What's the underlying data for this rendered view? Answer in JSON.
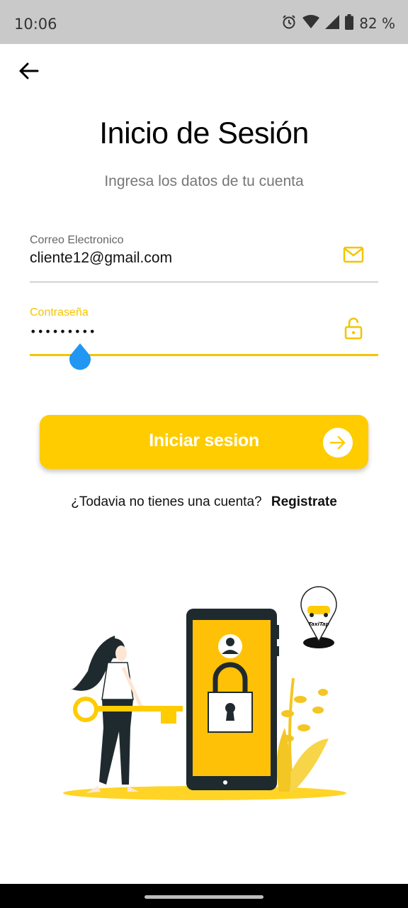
{
  "status_bar": {
    "time": "10:06",
    "battery": "82 %",
    "icons": [
      "alarm-icon",
      "wifi-icon",
      "signal-icon",
      "battery-icon"
    ]
  },
  "header": {
    "back_icon": "back-arrow-icon",
    "title": "Inicio de Sesión",
    "subtitle": "Ingresa los datos de tu cuenta"
  },
  "form": {
    "email": {
      "label": "Correo Electronico",
      "value": "cliente12@gmail.com",
      "icon": "mail-icon"
    },
    "password": {
      "label": "Contraseña",
      "value": "•••••••••",
      "icon": "unlock-icon"
    }
  },
  "login_button": {
    "label": "Iniciar sesion",
    "icon": "arrow-right-circle-icon"
  },
  "register": {
    "prompt": "¿Todavia no tienes una cuenta?",
    "link": "Registrate"
  },
  "illustration": {
    "logo_text": "TaxiTap"
  },
  "colors": {
    "accent": "#ffcc00",
    "accent_text": "#f5c400",
    "cursor_handle": "#2196f3",
    "status_bar": "#c9c9c9"
  }
}
